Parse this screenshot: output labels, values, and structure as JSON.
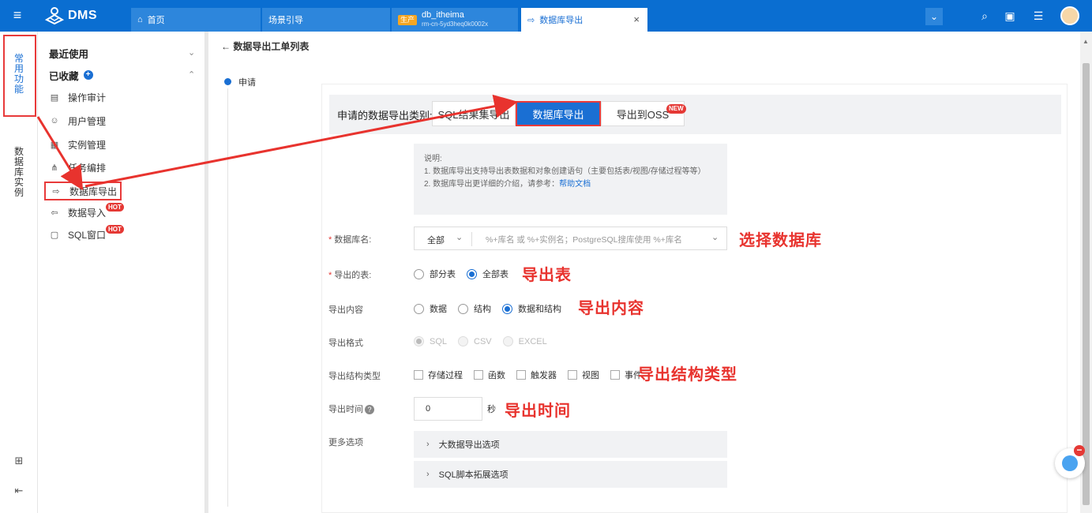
{
  "app": {
    "name": "DMS"
  },
  "tabs": [
    {
      "label": "首页"
    },
    {
      "label": "场景引导"
    },
    {
      "env": "生产",
      "label": "db_itheima",
      "sub": "rm-cn-5yd3heq0k0002x"
    },
    {
      "label": "数据库导出"
    }
  ],
  "rail": {
    "common": "常\n用\n功\n能",
    "instances": "数\n据\n库\n实\n例"
  },
  "sidebar": {
    "recent": "最近使用",
    "favorites": "已收藏",
    "items": [
      {
        "label": "操作审计",
        "icon": "audit-icon"
      },
      {
        "label": "用户管理",
        "icon": "user-icon"
      },
      {
        "label": "实例管理",
        "icon": "instance-icon"
      },
      {
        "label": "任务编排",
        "icon": "workflow-icon"
      },
      {
        "label": "数据库导出",
        "icon": "export-icon"
      },
      {
        "label": "数据导入",
        "icon": "import-icon",
        "badge": "HOT"
      },
      {
        "label": "SQL窗口",
        "icon": "sql-window-icon",
        "badge": "HOT"
      }
    ]
  },
  "main": {
    "back": "← 数据导出工单列表",
    "step": "申请",
    "category": {
      "label": "申请的数据导出类别:",
      "options": [
        "SQL结果集导出",
        "数据库导出",
        "导出到OSS"
      ],
      "new_badge": "NEW"
    },
    "info": {
      "title": "说明:",
      "line1": "1. 数据库导出支持导出表数据和对象创建语句（主要包括表/视图/存储过程等等）",
      "line2_prefix": "2. 数据库导出更详细的介绍，请参考：",
      "line2_link": "帮助文档"
    },
    "db": {
      "label": "数据库名:",
      "scope": "全部",
      "placeholder": "%+库名 或 %+实例名；PostgreSQL搜库使用 %+库名"
    },
    "tables": {
      "label": "导出的表:",
      "options": [
        "部分表",
        "全部表"
      ]
    },
    "content": {
      "label": "导出内容",
      "options": [
        "数据",
        "结构",
        "数据和结构"
      ]
    },
    "format": {
      "label": "导出格式",
      "options": [
        "SQL",
        "CSV",
        "EXCEL"
      ]
    },
    "struct_types": {
      "label": "导出结构类型",
      "options": [
        "存储过程",
        "函数",
        "触发器",
        "视图",
        "事件"
      ]
    },
    "time": {
      "label": "导出时间",
      "value": "0",
      "unit": "秒"
    },
    "more": {
      "label": "更多选项",
      "sections": [
        "大数据导出选项",
        "SQL脚本拓展选项"
      ]
    }
  },
  "annotations": {
    "select_db": "选择数据库",
    "export_tables": "导出表",
    "export_content": "导出内容",
    "export_struct": "导出结构类型",
    "export_time": "导出时间"
  },
  "colors": {
    "brand": "#0a6ed1",
    "accent": "#1a6fd3",
    "annotation": "#e8332e"
  }
}
